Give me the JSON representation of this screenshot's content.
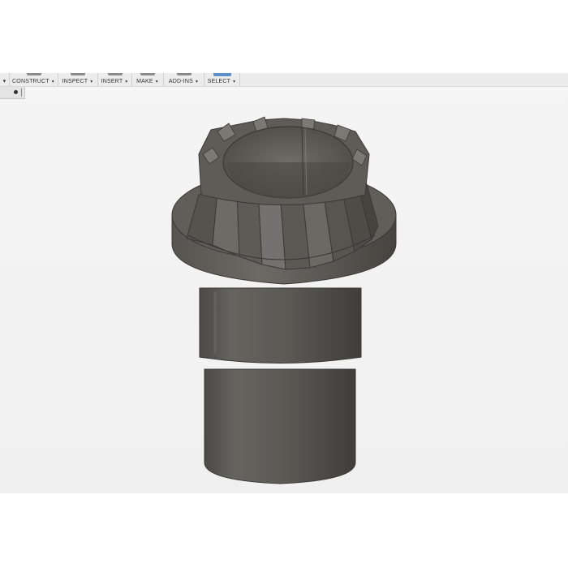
{
  "toolbar": {
    "menus": [
      {
        "label": "CONSTRUCT",
        "active": false
      },
      {
        "label": "INSPECT",
        "active": false
      },
      {
        "label": "INSERT",
        "active": false
      },
      {
        "label": "MAKE",
        "active": false
      },
      {
        "label": "ADD-INS",
        "active": false
      },
      {
        "label": "SELECT",
        "active": true
      }
    ]
  },
  "colors": {
    "canvas_bg": "#f2f2f2",
    "model_body": "#5e5d58",
    "model_highlight": "#8a8983",
    "model_shadow": "#3d3c38",
    "accent": "#5b8fc9"
  },
  "model": {
    "type": "bevel-gear-shaft",
    "tooth_count": 13
  }
}
